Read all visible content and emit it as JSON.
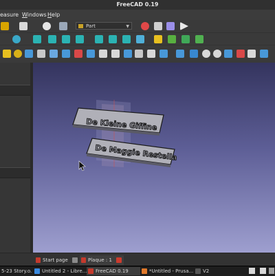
{
  "window": {
    "title": "FreeCAD 0.19"
  },
  "menu": {
    "items": [
      "easure",
      "Windows",
      "Help"
    ],
    "underline_letters": [
      "W",
      "H"
    ]
  },
  "toolbar": {
    "workbench": "Part"
  },
  "viewport": {
    "plate1_text": "De Kleine Giffine",
    "plate2_text": "De Maggie Restella"
  },
  "tabs": [
    {
      "label": "Start page"
    },
    {
      "label": "Plaque : 1"
    }
  ],
  "taskbar": [
    {
      "label": "5-23 Story.o..."
    },
    {
      "label": "Untitled 2 - Libre..."
    },
    {
      "label": "FreeCAD 0.19"
    },
    {
      "label": "*Untitled - Prusa..."
    },
    {
      "label": "V2"
    }
  ],
  "colors": {
    "accent": "#c43a2d",
    "viewport_top": "#34345e",
    "viewport_bottom": "#9e9fcf"
  }
}
